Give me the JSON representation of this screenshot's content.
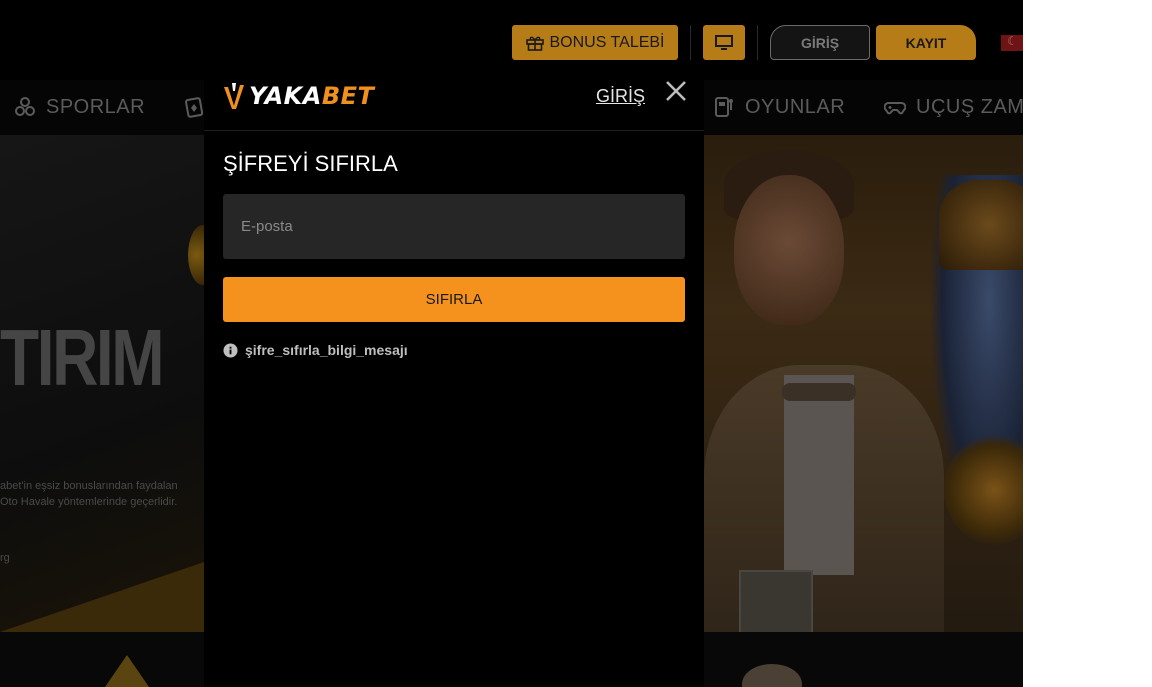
{
  "colors": {
    "accent": "#f5921d",
    "header_button": "#b57c17",
    "modal_bg": "#000000",
    "input_bg": "#262626"
  },
  "header": {
    "bonus_label": "BONUS TALEBİ",
    "login_label": "GİRİŞ",
    "register_label": "KAYIT",
    "monitor_icon": "monitor-icon",
    "bonus_icon": "gift-icon",
    "language_icon": "turkey-flag-icon"
  },
  "nav": {
    "items": [
      {
        "label": "SPORLAR",
        "icon": "soccer-balls-icon"
      },
      {
        "label": "",
        "icon": "playing-cards-icon"
      },
      {
        "label": "OYUNLAR",
        "icon": "slot-machine-icon"
      },
      {
        "label": "UÇUŞ ZAMA",
        "icon": "gamepad-icon"
      }
    ]
  },
  "banner": {
    "big_text": "TIRIM",
    "line1": "abet'in eşsiz bonuslarından faydalan",
    "line2": "Oto Havale yöntemlerinde geçerlidir.",
    "line3": "rg"
  },
  "modal": {
    "logo": {
      "white": "YAKA",
      "orange": "BET"
    },
    "login_link": "GİRİŞ",
    "close_icon": "close-icon",
    "title": "ŞİFREYİ SIFIRLA",
    "email_placeholder": "E-posta",
    "reset_label": "SIFIRLA",
    "info_text": "şifre_sıfırla_bilgi_mesajı",
    "info_icon": "info-icon"
  }
}
